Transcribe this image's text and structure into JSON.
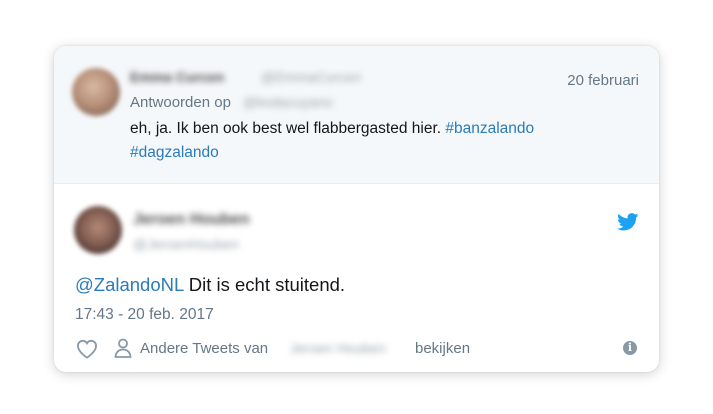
{
  "parent_tweet": {
    "author_name": "Emma Curcen",
    "author_handle": "@EmmaCurcen",
    "date": "20 februari",
    "reply_prefix": "Antwoorden op",
    "reply_handle": "@kodacuyano",
    "text_main": "eh, ja. Ik ben ook best wel flabbergasted hier. ",
    "hashtag1": "#banzalando",
    "hashtag2": "#dagzalando"
  },
  "main_tweet": {
    "author_name": "Jeroen Houben",
    "author_handle": "@JeroenHouben",
    "mention": "@ZalandoNL",
    "text": " Dit is echt stuitend.",
    "timestamp": "17:43 - 20 feb. 2017"
  },
  "actions": {
    "more_prefix": "Andere Tweets van",
    "more_name": "Jeroen Houben",
    "more_suffix": "bekijken",
    "info_glyph": "i"
  },
  "colors": {
    "link": "#2b7bb9",
    "twitter_blue": "#1da1f2",
    "muted": "#657786",
    "parent_bg": "#f5f8fa"
  },
  "icons": [
    "twitter-bird-icon",
    "heart-icon",
    "person-icon",
    "info-icon"
  ]
}
